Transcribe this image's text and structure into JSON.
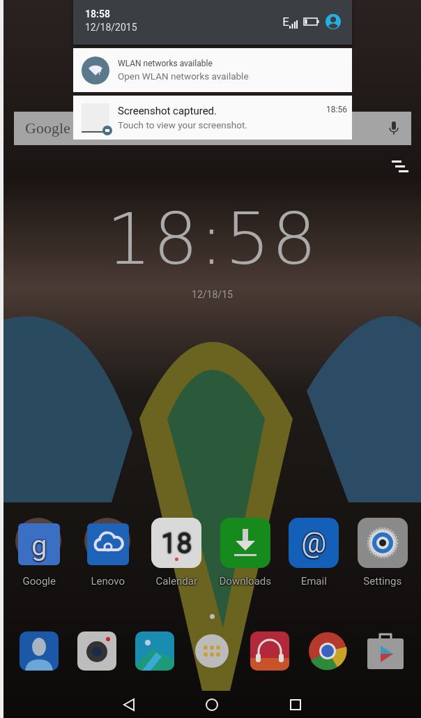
{
  "status": {
    "time": "18:58",
    "date": "12/18/2015",
    "network": "E"
  },
  "notifications": [
    {
      "kind": "wifi",
      "title": "WLAN networks available",
      "text": "Open WLAN networks available",
      "glyph": "?"
    },
    {
      "kind": "screenshot",
      "title": "Screenshot captured.",
      "text": "Touch to view your screenshot.",
      "time": "18:56"
    }
  ],
  "search_bar": {
    "logo": "Google"
  },
  "clock": {
    "time": "18:58",
    "date": "12/18/15"
  },
  "apps": [
    {
      "label": "Google",
      "kind": "google",
      "glyph": "g"
    },
    {
      "label": "Lenovo",
      "kind": "cloud"
    },
    {
      "label": "Calendar",
      "kind": "calendar",
      "glyph": "18"
    },
    {
      "label": "Downloads",
      "kind": "download"
    },
    {
      "label": "Email",
      "kind": "email",
      "glyph": "@"
    },
    {
      "label": "Settings",
      "kind": "settings"
    }
  ],
  "dock": [
    {
      "kind": "contacts"
    },
    {
      "kind": "camera"
    },
    {
      "kind": "gallery"
    },
    {
      "kind": "drawer"
    },
    {
      "kind": "music"
    },
    {
      "kind": "browser"
    },
    {
      "kind": "store"
    }
  ]
}
